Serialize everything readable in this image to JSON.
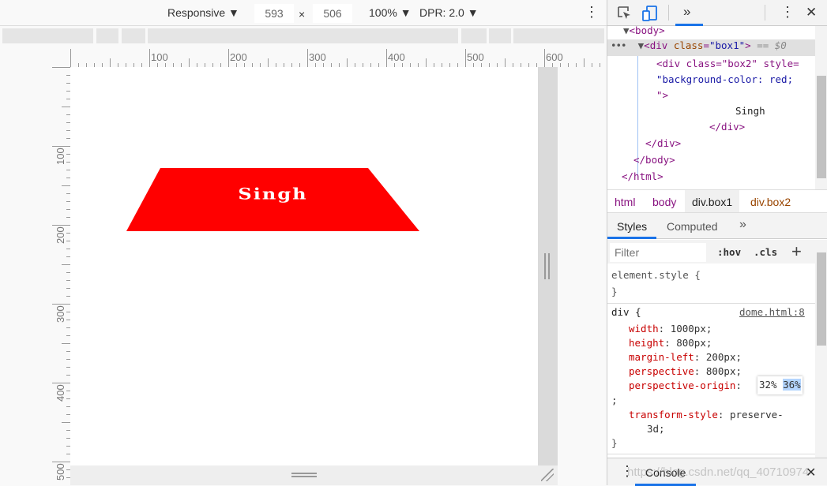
{
  "toolbar": {
    "device": "Responsive ▼",
    "width": "593",
    "times": "×",
    "height": "506",
    "zoom": "100% ▼",
    "dpr": "DPR: 2.0 ▼",
    "menu": "⋮"
  },
  "rulers": {
    "h": [
      "100",
      "200",
      "300",
      "400",
      "500",
      "600"
    ],
    "v": [
      "100",
      "200",
      "300",
      "400",
      "500"
    ]
  },
  "page": {
    "box_text": "Singh",
    "box_color": "#ff0000"
  },
  "devtools": {
    "more_tabs": "»",
    "menu": "⋮",
    "close": "✕",
    "dom": {
      "body_open": "<body>",
      "div1_open": "<div class=\"box1\">",
      "selected_marker": "== $0",
      "div2_open_a": "<div class=\"box2\" style=",
      "div2_style": "\"background-color: red;",
      "div2_close_quote": "\">",
      "text": "Singh",
      "div2_close": "</div>",
      "div1_close": "</div>",
      "body_close": "</body>",
      "html_close": "</html>",
      "ellipsis": "•••"
    },
    "breadcrumbs": [
      "html",
      "body",
      "div.box1",
      "div.box2"
    ],
    "tabs": {
      "styles": "Styles",
      "computed": "Computed",
      "more": "»"
    },
    "filter_placeholder": "Filter",
    "hov": ":hov",
    "cls": ".cls",
    "plus": "+",
    "element_style": "element.style {",
    "close_brace": "}",
    "rule": {
      "selector": "div {",
      "source": "dome.html:8",
      "props": [
        {
          "name": "width",
          "value": "1000px;"
        },
        {
          "name": "height",
          "value": "800px;"
        },
        {
          "name": "margin-left",
          "value": "200px;"
        },
        {
          "name": "perspective",
          "value": "800px;"
        }
      ],
      "origin_name": "perspective-origin",
      "origin_v1": "32%",
      "origin_v2": "36%",
      "semicolon": ";",
      "ts_name": "transform-style",
      "ts_value": "preserve-",
      "ts_value2": "3d;"
    },
    "drawer": {
      "menu": "⋮",
      "console": "Console",
      "close": "✕",
      "watermark": "https://blog.csdn.net/qq_40710974"
    }
  }
}
